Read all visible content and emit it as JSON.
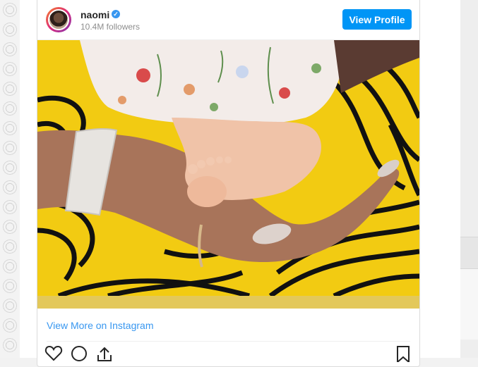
{
  "post": {
    "username": "naomi",
    "verified": true,
    "followers": "10.4M followers",
    "view_profile_label": "View Profile",
    "view_more_label": "View More on Instagram"
  },
  "colors": {
    "accent": "#0095f6",
    "link": "#3897f0",
    "verified_badge": "#3897f0"
  },
  "icons": [
    "heart-icon",
    "comment-icon",
    "share-icon",
    "bookmark-icon",
    "verified-badge-icon"
  ]
}
